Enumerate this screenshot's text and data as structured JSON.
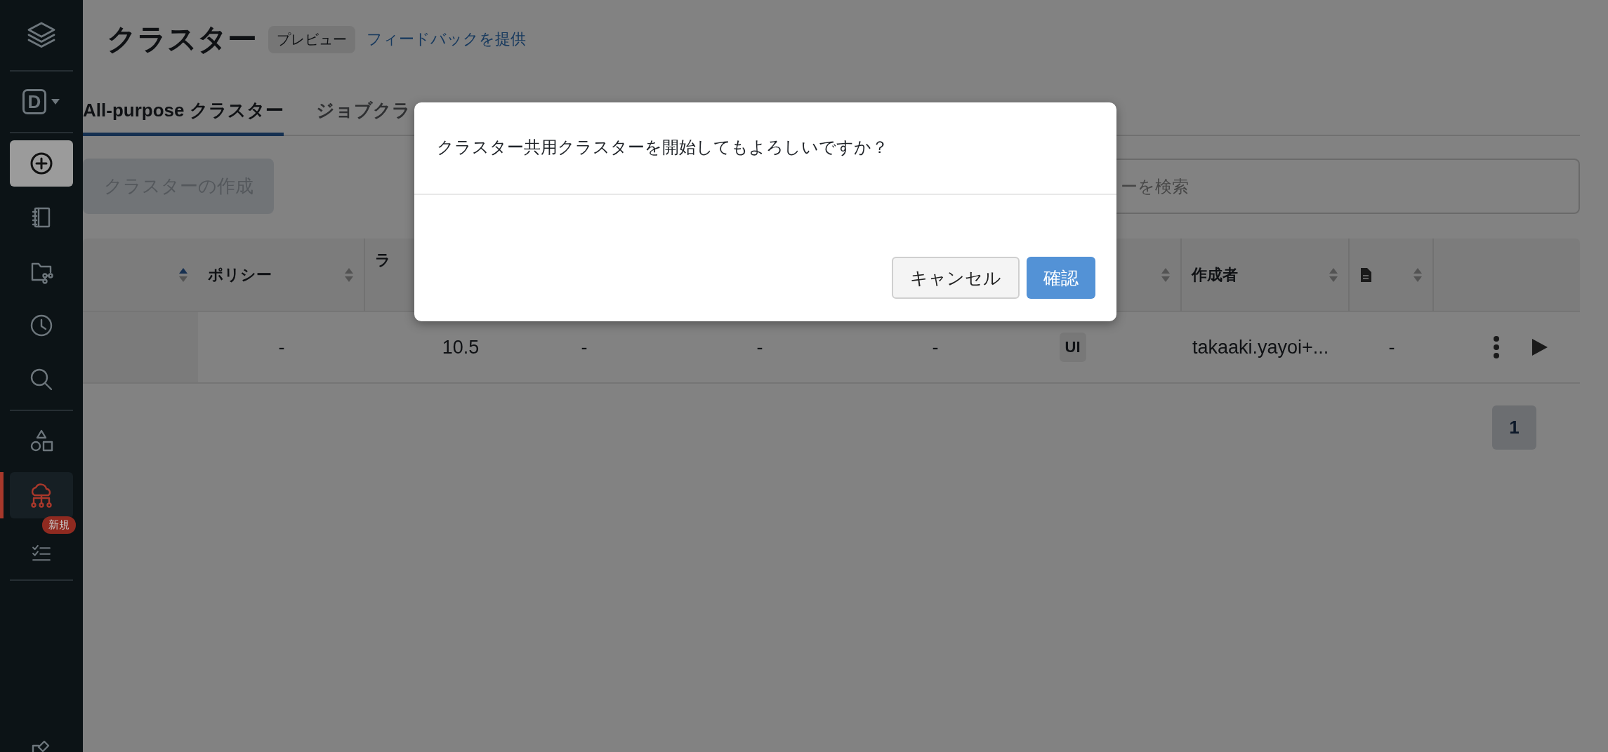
{
  "sidebar": {
    "sections": [
      [
        {
          "kind": "logo",
          "selected": false
        }
      ],
      [
        {
          "kind": "workspace",
          "label": "D",
          "selected": false
        }
      ],
      [
        {
          "kind": "create",
          "selected": false
        },
        {
          "kind": "notebook",
          "selected": false
        },
        {
          "kind": "repos",
          "selected": false
        },
        {
          "kind": "history",
          "selected": false
        },
        {
          "kind": "search",
          "selected": false
        }
      ],
      [
        {
          "kind": "shapes",
          "selected": false
        },
        {
          "kind": "cluster",
          "selected": true
        },
        {
          "kind": "checklist",
          "selected": false,
          "badge": "新規"
        }
      ],
      [
        {
          "kind": "partial",
          "selected": false
        }
      ]
    ]
  },
  "header": {
    "title": "クラスター",
    "badge": "プレビュー",
    "link": "フィードバックを提供"
  },
  "tabs": [
    {
      "label": "All-purpose クラスター",
      "selected": true
    },
    {
      "label": "ジョブクラ",
      "selected": false
    }
  ],
  "create_button": {
    "label": "クラスターの作成",
    "disabled": true
  },
  "search": {
    "placeholder": "ーを検索"
  },
  "table": {
    "columns": [
      {
        "sorted": true
      },
      {
        "label": "ポリシー",
        "sorted": false
      },
      {
        "label": "ラ"
      },
      {},
      {},
      {},
      {
        "sorted": false
      },
      {
        "label": "作成者",
        "sorted": false
      },
      {
        "kind": "document",
        "sorted": false
      },
      {}
    ],
    "rows": [
      {
        "cells": [
          {
            "kind": "blank"
          },
          {
            "kind": "text",
            "text": "-"
          },
          {
            "kind": "text",
            "text": "10.5"
          },
          {
            "kind": "text",
            "text": "-"
          },
          {
            "kind": "text",
            "text": "-"
          },
          {
            "kind": "text",
            "text": "-"
          },
          {
            "kind": "tag",
            "text": "UI"
          },
          {
            "kind": "author",
            "text": "takaaki.yayoi+..."
          },
          {
            "kind": "text",
            "text": "-"
          },
          {
            "kind": "actions"
          }
        ]
      }
    ]
  },
  "pagination": [
    {
      "label": "1",
      "selected": true
    }
  ],
  "dialog": {
    "message": "クラスター共用クラスターを開始してもよろしいですか？",
    "buttons": [
      {
        "label": "キャンセル",
        "kind": "secondary"
      },
      {
        "label": "確認",
        "kind": "primary"
      }
    ]
  }
}
